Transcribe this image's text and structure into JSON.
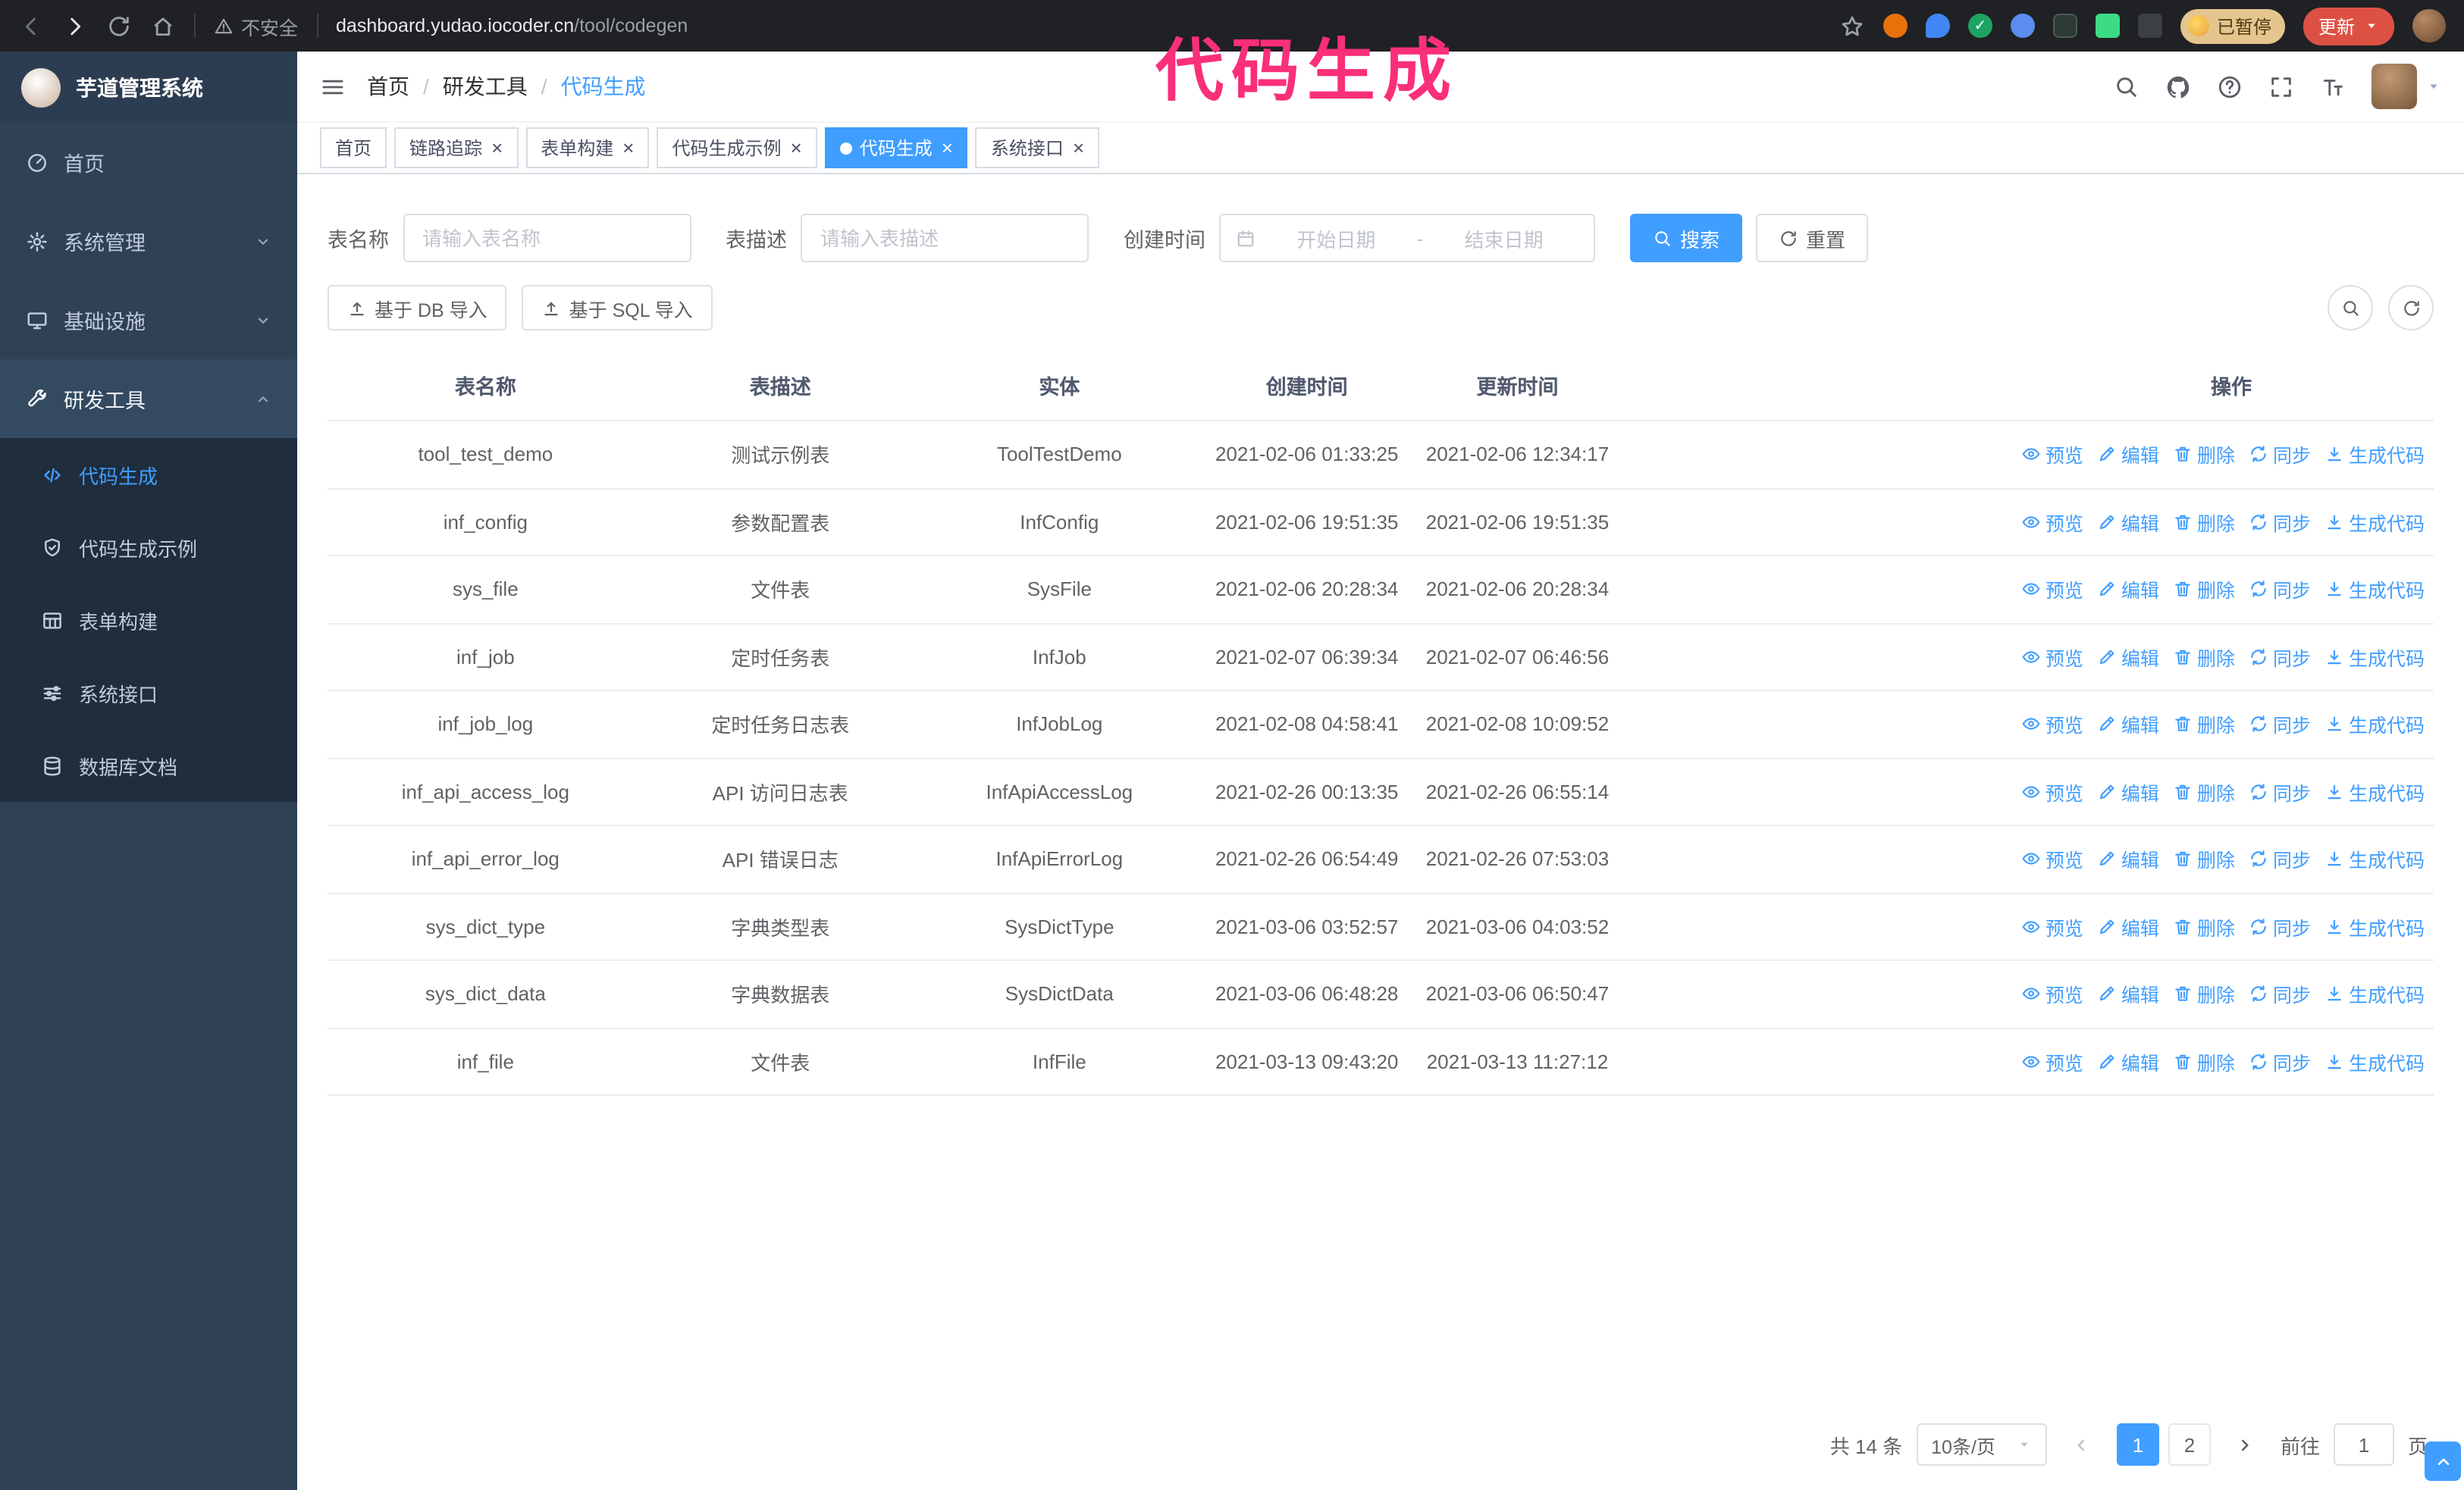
{
  "colors": {
    "accent": "#409eff",
    "annotation_pink": "#fa2f7a",
    "sidebar_bg": "#304156",
    "submenu_bg": "#1f2d3d",
    "chrome_bg": "#202124"
  },
  "annotation": {
    "text": "代码生成"
  },
  "browser": {
    "security_label": "不安全",
    "url_domain": "dashboard.yudao.iocoder.cn",
    "url_path": "/tool/codegen",
    "paused_badge_label": "已暂停",
    "update_button_label": "更新"
  },
  "sidebar": {
    "logo_title": "芋道管理系统",
    "items": [
      {
        "id": "home",
        "label": "首页",
        "icon": "dashboard"
      },
      {
        "id": "system-mgmt",
        "label": "系统管理",
        "icon": "gear",
        "expandable": true
      },
      {
        "id": "infrastructure",
        "label": "基础设施",
        "icon": "monitor",
        "expandable": true
      },
      {
        "id": "dev-tools",
        "label": "研发工具",
        "icon": "wrench",
        "expandable": true,
        "expanded": true,
        "children": [
          {
            "id": "codegen",
            "label": "代码生成",
            "icon": "code",
            "active": true
          },
          {
            "id": "codegen-example",
            "label": "代码生成示例",
            "icon": "badge"
          },
          {
            "id": "form-builder",
            "label": "表单构建",
            "icon": "grid"
          },
          {
            "id": "system-api",
            "label": "系统接口",
            "icon": "sliders"
          },
          {
            "id": "db-doc",
            "label": "数据库文档",
            "icon": "db"
          }
        ]
      }
    ]
  },
  "header": {
    "breadcrumb": [
      "首页",
      "研发工具",
      "代码生成"
    ],
    "separator": "/"
  },
  "tabs": [
    {
      "id": "home",
      "label": "首页",
      "closable": false,
      "active": false
    },
    {
      "id": "tracing",
      "label": "链路追踪",
      "closable": true,
      "active": false
    },
    {
      "id": "form-builder",
      "label": "表单构建",
      "closable": true,
      "active": false
    },
    {
      "id": "codegen-example",
      "label": "代码生成示例",
      "closable": true,
      "active": false
    },
    {
      "id": "codegen",
      "label": "代码生成",
      "closable": true,
      "active": true
    },
    {
      "id": "system-api",
      "label": "系统接口",
      "closable": true,
      "active": false
    }
  ],
  "filter": {
    "table_name_label": "表名称",
    "table_name_placeholder": "请输入表名称",
    "table_desc_label": "表描述",
    "table_desc_placeholder": "请输入表描述",
    "create_time_label": "创建时间",
    "date_start_placeholder": "开始日期",
    "date_range_separator": "-",
    "date_end_placeholder": "结束日期",
    "search_button_label": "搜索",
    "reset_button_label": "重置"
  },
  "toolbar": {
    "import_db_label": "基于 DB 导入",
    "import_sql_label": "基于 SQL 导入"
  },
  "table": {
    "columns": [
      "表名称",
      "表描述",
      "实体",
      "创建时间",
      "更新时间",
      "操作"
    ],
    "actions": [
      {
        "id": "preview",
        "label": "预览",
        "icon": "eye"
      },
      {
        "id": "edit",
        "label": "编辑",
        "icon": "edit"
      },
      {
        "id": "delete",
        "label": "删除",
        "icon": "trash"
      },
      {
        "id": "sync",
        "label": "同步",
        "icon": "sync"
      },
      {
        "id": "generate-code",
        "label": "生成代码",
        "icon": "download"
      }
    ],
    "rows": [
      {
        "name": "tool_test_demo",
        "description": "测试示例表",
        "entity": "ToolTestDemo",
        "created": "2021-02-06 01:33:25",
        "updated": "2021-02-06 12:34:17"
      },
      {
        "name": "inf_config",
        "description": "参数配置表",
        "entity": "InfConfig",
        "created": "2021-02-06 19:51:35",
        "updated": "2021-02-06 19:51:35"
      },
      {
        "name": "sys_file",
        "description": "文件表",
        "entity": "SysFile",
        "created": "2021-02-06 20:28:34",
        "updated": "2021-02-06 20:28:34"
      },
      {
        "name": "inf_job",
        "description": "定时任务表",
        "entity": "InfJob",
        "created": "2021-02-07 06:39:34",
        "updated": "2021-02-07 06:46:56"
      },
      {
        "name": "inf_job_log",
        "description": "定时任务日志表",
        "entity": "InfJobLog",
        "created": "2021-02-08 04:58:41",
        "updated": "2021-02-08 10:09:52"
      },
      {
        "name": "inf_api_access_log",
        "description": "API 访问日志表",
        "entity": "InfApiAccessLog",
        "created": "2021-02-26 00:13:35",
        "updated": "2021-02-26 06:55:14"
      },
      {
        "name": "inf_api_error_log",
        "description": "API 错误日志",
        "entity": "InfApiErrorLog",
        "created": "2021-02-26 06:54:49",
        "updated": "2021-02-26 07:53:03"
      },
      {
        "name": "sys_dict_type",
        "description": "字典类型表",
        "entity": "SysDictType",
        "created": "2021-03-06 03:52:57",
        "updated": "2021-03-06 04:03:52"
      },
      {
        "name": "sys_dict_data",
        "description": "字典数据表",
        "entity": "SysDictData",
        "created": "2021-03-06 06:48:28",
        "updated": "2021-03-06 06:50:47"
      },
      {
        "name": "inf_file",
        "description": "文件表",
        "entity": "InfFile",
        "created": "2021-03-13 09:43:20",
        "updated": "2021-03-13 11:27:12"
      }
    ]
  },
  "pagination": {
    "total_text": "共 14 条",
    "page_size_label": "10条/页",
    "pages": [
      {
        "label": "1",
        "active": true
      },
      {
        "label": "2",
        "active": false
      }
    ],
    "goto_label": "前往",
    "goto_value": "1",
    "goto_unit": "页"
  }
}
